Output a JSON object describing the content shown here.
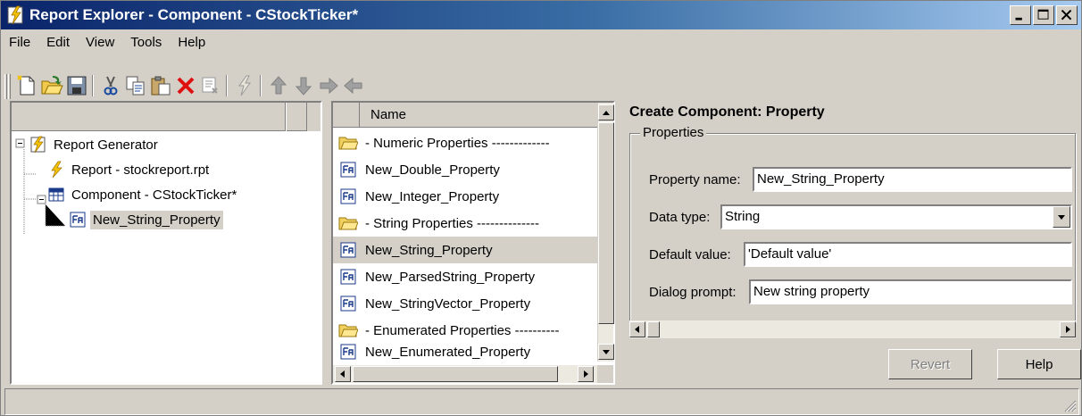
{
  "window": {
    "title": "Report Explorer - Component - CStockTicker*"
  },
  "menu": [
    "File",
    "Edit",
    "View",
    "Tools",
    "Help"
  ],
  "toolbar": {
    "buttons": [
      {
        "name": "new-icon"
      },
      {
        "name": "open-icon"
      },
      {
        "name": "save-icon"
      },
      {
        "name": "cut-icon"
      },
      {
        "name": "copy-icon"
      },
      {
        "name": "paste-icon"
      },
      {
        "name": "delete-icon"
      },
      {
        "name": "disable-component-icon"
      },
      {
        "name": "run-report-icon"
      },
      {
        "name": "move-up-icon"
      },
      {
        "name": "move-down-icon"
      },
      {
        "name": "demote-icon"
      },
      {
        "name": "promote-icon"
      }
    ]
  },
  "tree": {
    "items": [
      {
        "label": "Report Generator",
        "icon": "report-generator-icon"
      },
      {
        "label": "Report - stockreport.rpt",
        "icon": "report-icon"
      },
      {
        "label": "Component - CStockTicker*",
        "icon": "component-icon"
      },
      {
        "label": "New_String_Property",
        "icon": "property-icon",
        "selected": true
      }
    ]
  },
  "list": {
    "header": "Name",
    "items": [
      {
        "label": "- Numeric Properties -------------",
        "icon": "folder-icon"
      },
      {
        "label": "New_Double_Property",
        "icon": "property-icon"
      },
      {
        "label": "New_Integer_Property",
        "icon": "property-icon"
      },
      {
        "label": "- String Properties --------------",
        "icon": "folder-icon"
      },
      {
        "label": "New_String_Property",
        "icon": "property-icon",
        "selected": true
      },
      {
        "label": "New_ParsedString_Property",
        "icon": "property-icon"
      },
      {
        "label": "New_StringVector_Property",
        "icon": "property-icon"
      },
      {
        "label": "- Enumerated Properties ----------",
        "icon": "folder-icon"
      },
      {
        "label": "New_Enumerated_Property",
        "icon": "property-icon"
      }
    ]
  },
  "properties": {
    "heading": "Create Component: Property",
    "group_label": "Properties",
    "name_label": "Property name:",
    "name_value": "New_String_Property",
    "type_label": "Data type:",
    "type_value": "String",
    "default_label": "Default value:",
    "default_value": "'Default value'",
    "prompt_label": "Dialog prompt:",
    "prompt_value": "New string property",
    "revert_label": "Revert",
    "help_label": "Help"
  },
  "colors": {
    "title_bar_start": "#0a246a",
    "title_bar_end": "#a6caf0",
    "chrome": "#d4d0c8"
  }
}
